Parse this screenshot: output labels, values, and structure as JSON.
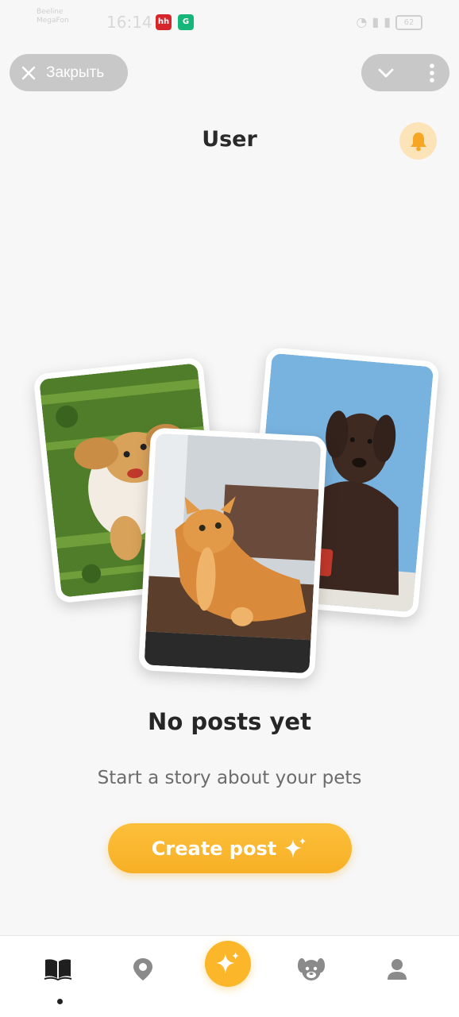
{
  "status_bar": {
    "carrier_line1": "Beeline",
    "carrier_line2": "MegaFon",
    "time": "16:14",
    "app_icons": [
      {
        "name": "hh-app-icon",
        "label": "hh",
        "color": "#d7262b"
      },
      {
        "name": "grammarly-app-icon",
        "label": "G",
        "color": "#16b57a"
      }
    ],
    "battery": "62"
  },
  "top_bar": {
    "close_label": "Закрыть"
  },
  "header": {
    "title": "User"
  },
  "empty_state": {
    "title": "No posts yet",
    "subtitle": "Start a story about your pets",
    "button_label": "Create post"
  },
  "bottom_nav": {
    "items": [
      {
        "name": "nav-feed",
        "icon": "book-icon",
        "active": true
      },
      {
        "name": "nav-map",
        "icon": "map-pin-icon",
        "active": false
      },
      {
        "name": "nav-create",
        "icon": "sparkle-icon",
        "active": false
      },
      {
        "name": "nav-pets",
        "icon": "dog-icon",
        "active": false
      },
      {
        "name": "nav-profile",
        "icon": "user-icon",
        "active": false
      }
    ]
  },
  "colors": {
    "accent": "#fbb62a",
    "pill_bg": "#c8c8c8",
    "bell_bg": "#fde3b8",
    "background": "#f7f7f7"
  }
}
